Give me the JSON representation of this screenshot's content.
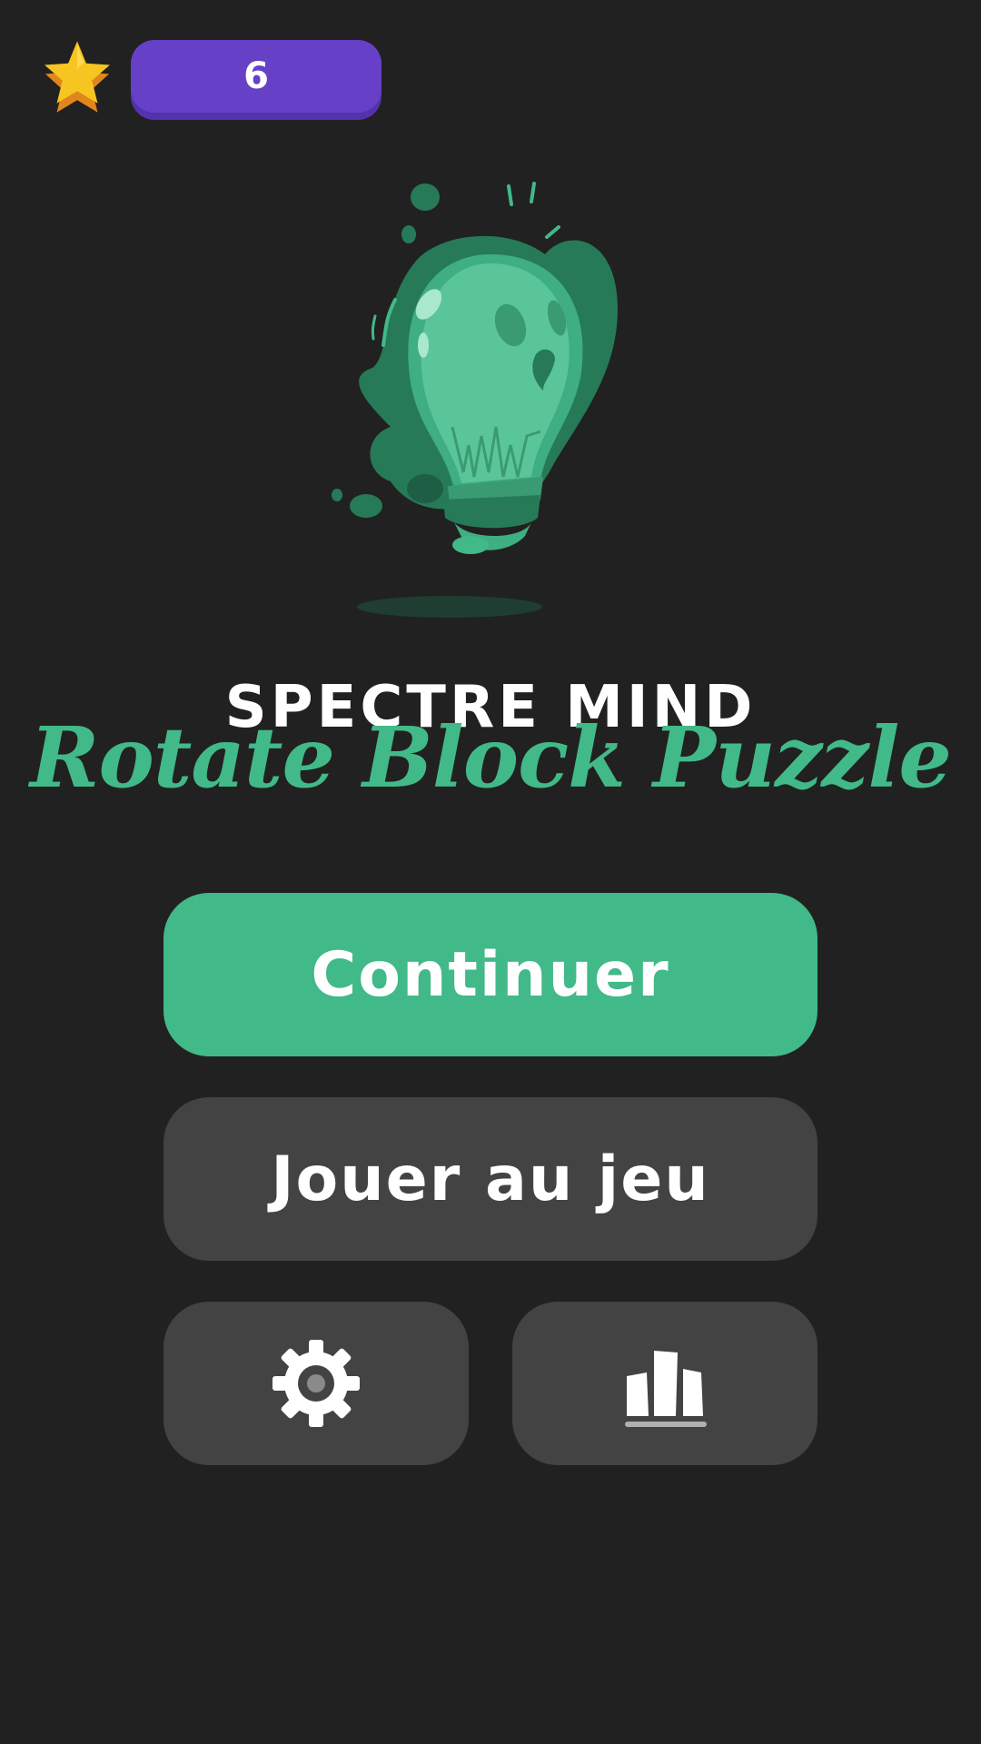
{
  "header": {
    "score": "6",
    "icon": "star-icon"
  },
  "titles": {
    "brand": "SPECTRE MIND",
    "game": "Rotate Block Puzzle"
  },
  "menu": {
    "continue_label": "Continuer",
    "play_label": "Jouer au jeu",
    "settings_icon": "gear-icon",
    "leaderboard_icon": "leaderboard-icon"
  },
  "colors": {
    "background": "#212121",
    "accent_green": "#42b988",
    "score_purple": "#6740c8",
    "button_gray": "#434343",
    "star_yellow": "#f7c51f"
  }
}
